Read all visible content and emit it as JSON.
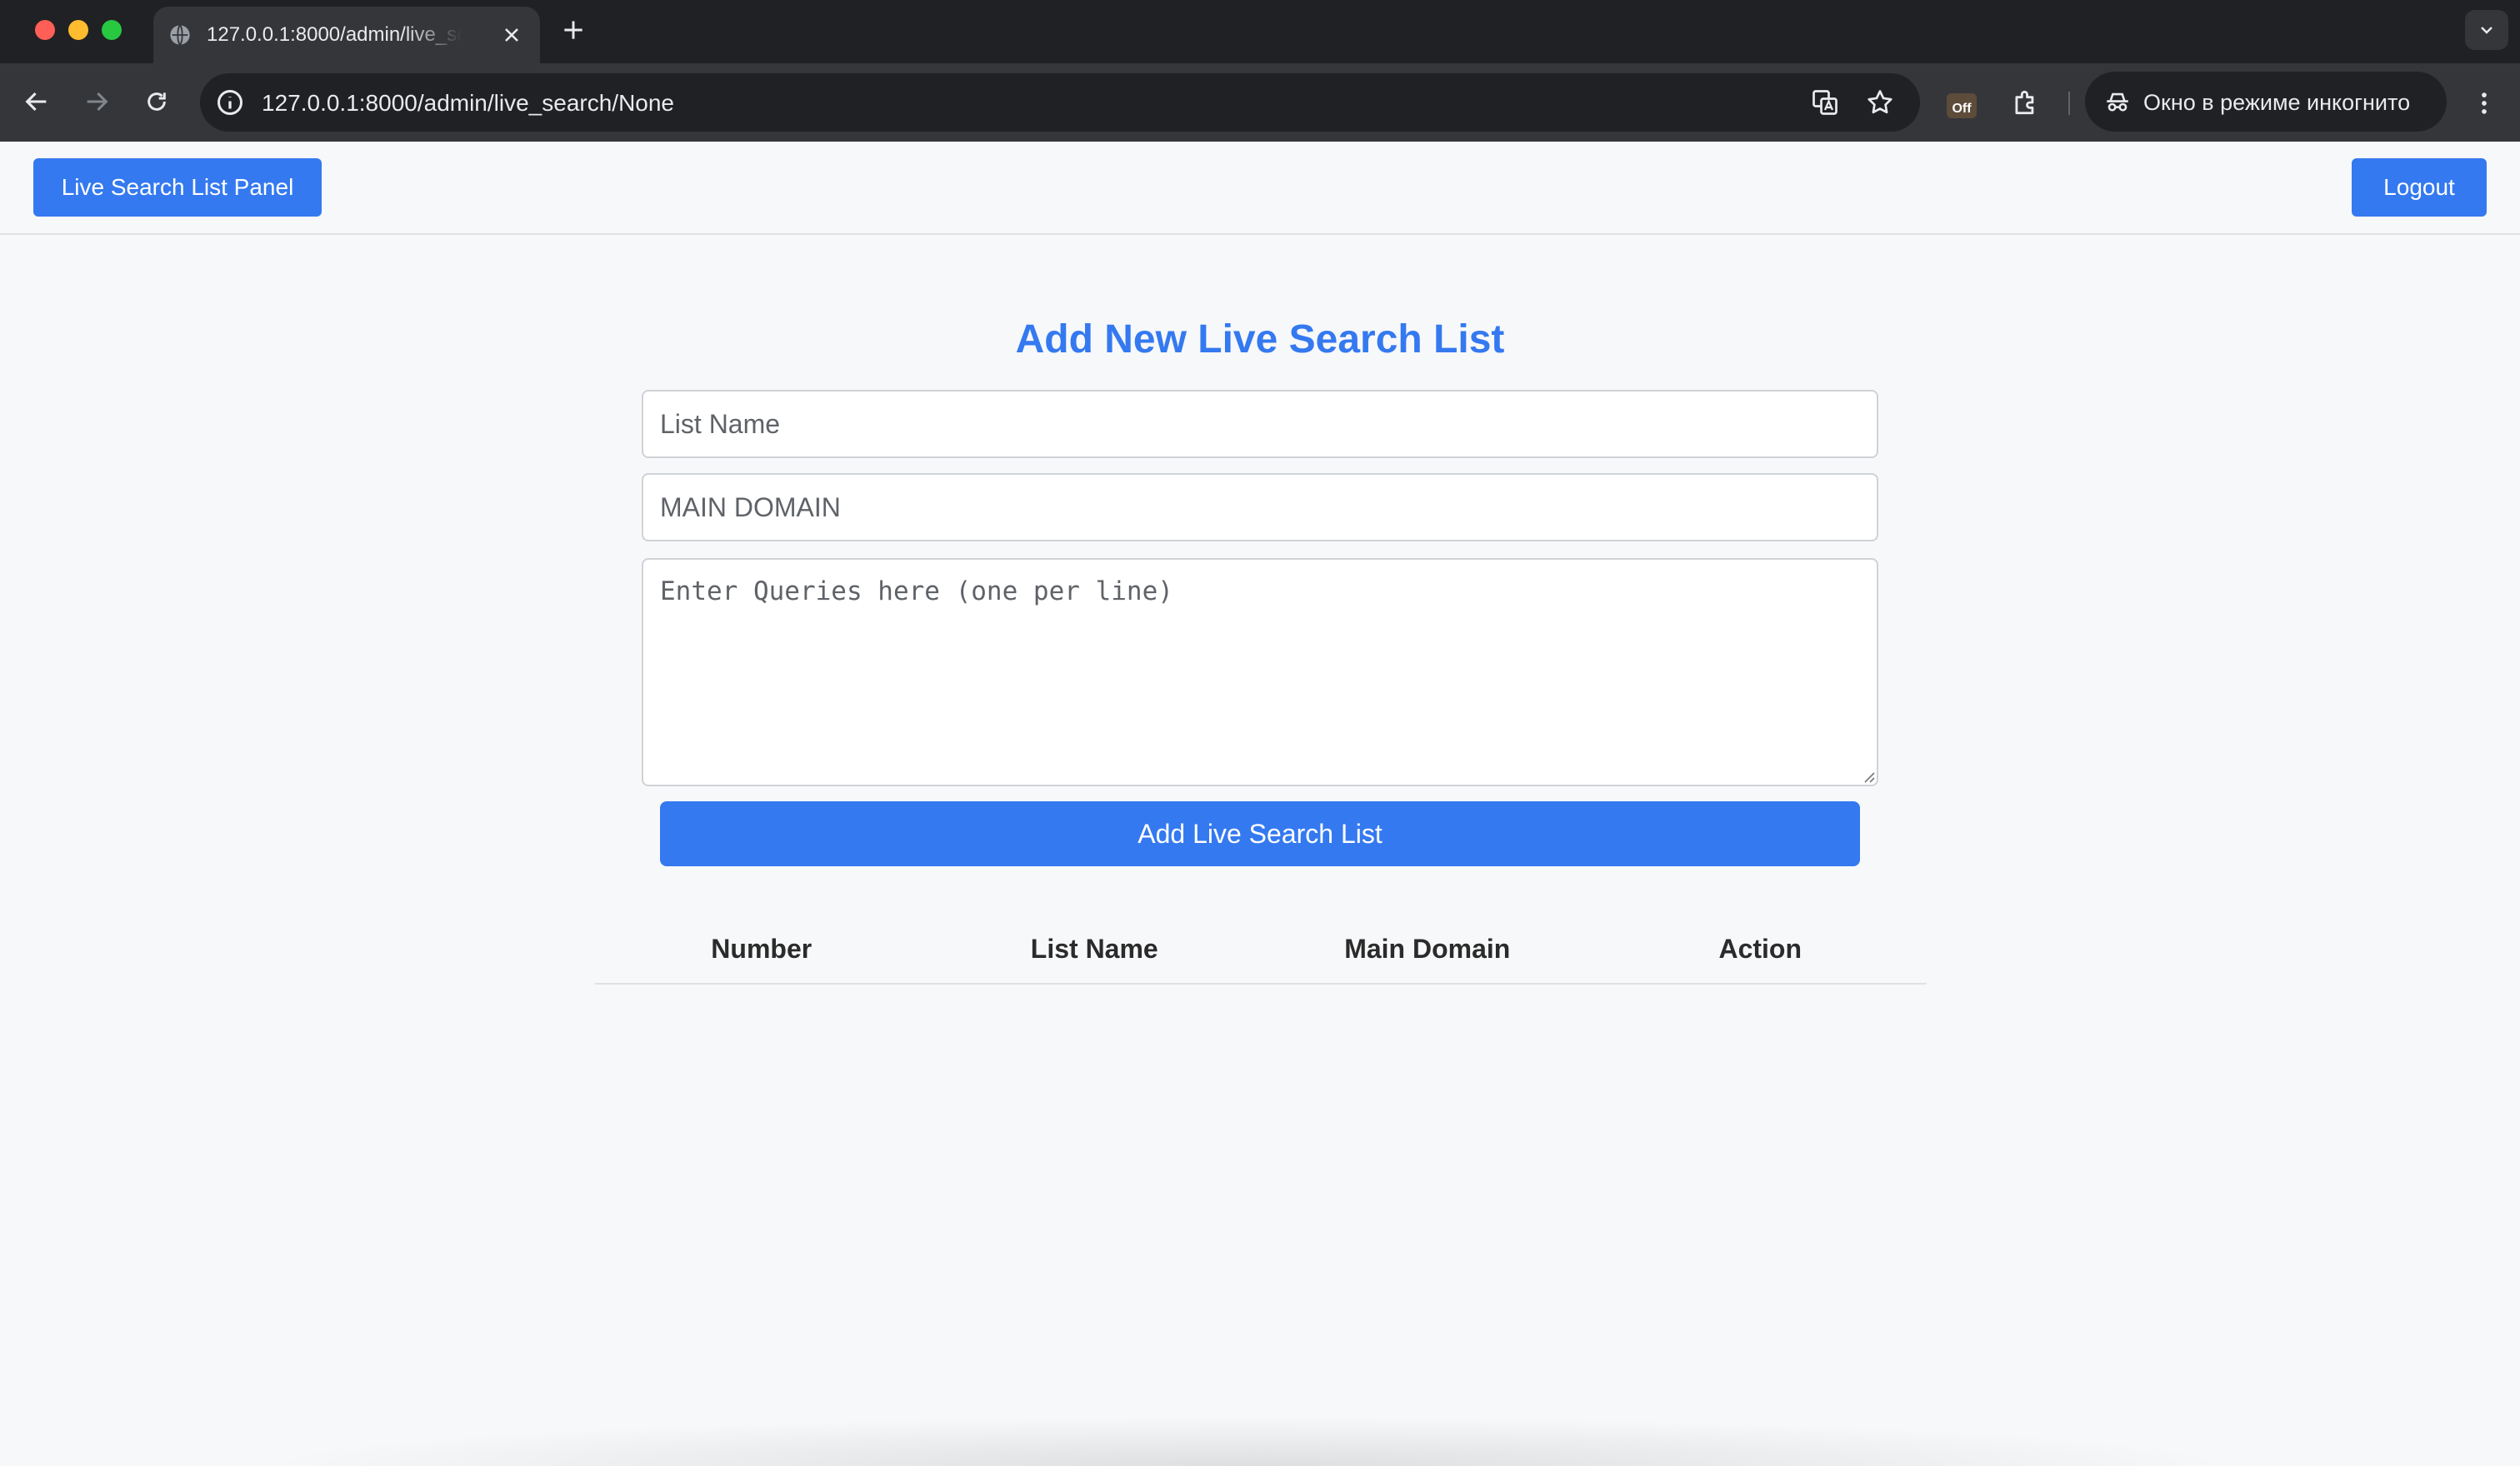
{
  "browser": {
    "tab_title": "127.0.0.1:8000/admin/live_search/None",
    "url": "127.0.0.1:8000/admin/live_search/None",
    "extension_badge": "Off",
    "incognito_label": "Окно в режиме инкогнито"
  },
  "nav": {
    "panel_button": "Live Search List Panel",
    "logout_button": "Logout"
  },
  "form": {
    "title": "Add New Live Search List",
    "list_name_placeholder": "List Name",
    "main_domain_placeholder": "MAIN DOMAIN",
    "queries_placeholder": "Enter Queries here (one per line)",
    "submit_button": "Add Live Search List"
  },
  "table": {
    "columns": [
      "Number",
      "List Name",
      "Main Domain",
      "Action"
    ],
    "rows": []
  },
  "colors": {
    "accent": "#3479f0",
    "chrome_dark": "#202124",
    "chrome_toolbar": "#35363a",
    "page_bg": "#f7f8fa"
  }
}
